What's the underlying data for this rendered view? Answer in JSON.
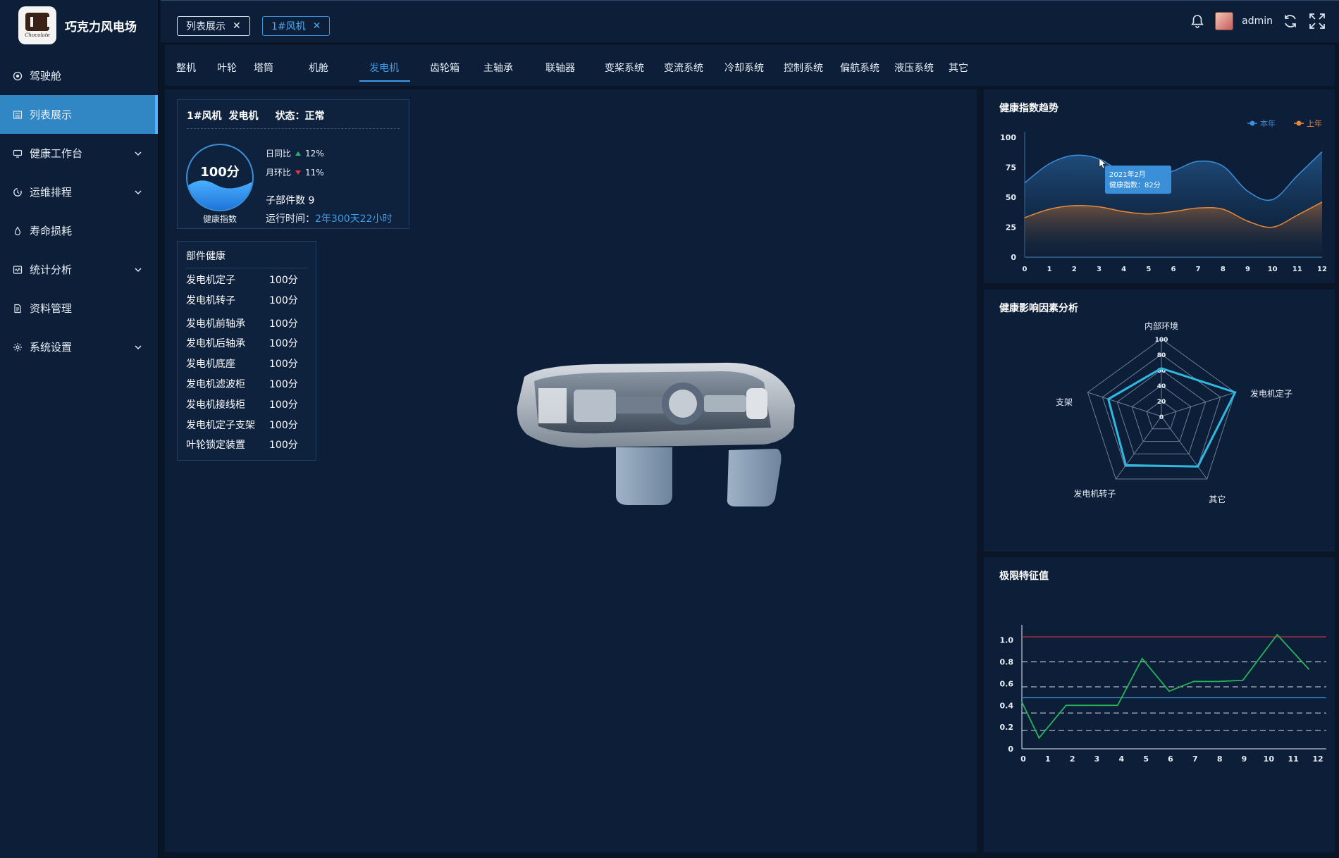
{
  "brand": {
    "name": "巧克力风电场",
    "logo_text": "Chocolate"
  },
  "sidebar": {
    "items": [
      {
        "label": "驾驶舱",
        "icon": "cockpit-icon",
        "active": false,
        "expandable": false
      },
      {
        "label": "列表展示",
        "icon": "list-icon",
        "active": true,
        "expandable": false
      },
      {
        "label": "健康工作台",
        "icon": "monitor-icon",
        "active": false,
        "expandable": true
      },
      {
        "label": "运维排程",
        "icon": "schedule-icon",
        "active": false,
        "expandable": true
      },
      {
        "label": "寿命损耗",
        "icon": "drop-icon",
        "active": false,
        "expandable": false
      },
      {
        "label": "统计分析",
        "icon": "chart-icon",
        "active": false,
        "expandable": true
      },
      {
        "label": "资料管理",
        "icon": "document-icon",
        "active": false,
        "expandable": false
      },
      {
        "label": "系统设置",
        "icon": "gear-icon",
        "active": false,
        "expandable": true
      }
    ]
  },
  "header": {
    "tabs": [
      {
        "label": "列表展示",
        "active": false
      },
      {
        "label": "1#风机",
        "active": true
      }
    ],
    "username": "admin"
  },
  "component_tabs": [
    "整机",
    "叶轮",
    "塔筒",
    "机舱",
    "发电机",
    "齿轮箱",
    "主轴承",
    "联轴器",
    "变桨系统",
    "变流系统",
    "冷却系统",
    "控制系统",
    "偏航系统",
    "液压系统",
    "其它"
  ],
  "active_component": "发电机",
  "status": {
    "turbine": "1#风机",
    "component": "发电机",
    "status_label": "状态：正常",
    "health_score": "100分",
    "health_value": 100,
    "health_label": "健康指数",
    "yoy_label": "日同比",
    "yoy_value": "12%",
    "mom_label": "月环比",
    "mom_value": "11%",
    "subcount": "子部件数 9",
    "runtime_label": "运行时间：",
    "runtime_value": "2年300天22小时"
  },
  "parts": {
    "title": "部件健康",
    "rows": [
      {
        "name": "发电机定子",
        "score": "100分"
      },
      {
        "name": "发电机转子",
        "score": "100分"
      },
      {
        "name": "发电机前轴承",
        "score": "100分"
      },
      {
        "name": "发电机后轴承",
        "score": "100分"
      },
      {
        "name": "发电机底座",
        "score": "100分"
      },
      {
        "name": "发电机滤波柜",
        "score": "100分"
      },
      {
        "name": "发电机接线柜",
        "score": "100分"
      },
      {
        "name": "发电机定子支架",
        "score": "100分"
      },
      {
        "name": "叶轮锁定装置",
        "score": "100分"
      }
    ]
  },
  "colors": {
    "accent": "#3d9be6",
    "series_this_year": "#3a8fd8",
    "series_last_year": "#e8893a",
    "limit_line": "#d9373f",
    "trend_line": "#27b35a"
  },
  "chart_data": [
    {
      "type": "area",
      "title": "健康指数趋势",
      "x": [
        0,
        1,
        2,
        3,
        4,
        5,
        6,
        7,
        8,
        9,
        10,
        11,
        12
      ],
      "yticks": [
        0,
        25,
        50,
        75,
        100
      ],
      "ylim": [
        0,
        100
      ],
      "legend_position": "top-right",
      "series": [
        {
          "name": "本年",
          "values": [
            62,
            78,
            85,
            82,
            70,
            66,
            72,
            80,
            76,
            55,
            48,
            68,
            88
          ]
        },
        {
          "name": "上年",
          "values": [
            33,
            40,
            43,
            42,
            38,
            36,
            38,
            41,
            40,
            30,
            25,
            35,
            46
          ]
        }
      ],
      "tooltip": {
        "title": "2021年2月",
        "text": "健康指数：82分"
      }
    },
    {
      "type": "radar",
      "title": "健康影响因素分析",
      "indicators": [
        "内部环境",
        "发电机定子",
        "其它",
        "发电机转子",
        "支架"
      ],
      "ticks": [
        "0",
        "20",
        "40",
        "60",
        "80",
        "100"
      ],
      "max": 100,
      "values": [
        62,
        100,
        80,
        78,
        72
      ]
    },
    {
      "type": "line",
      "title": "极限特征值",
      "x": [
        0,
        1,
        2,
        3,
        4,
        5,
        6,
        7,
        8,
        9,
        10,
        11,
        12
      ],
      "xticks": [
        "0",
        "1",
        "2",
        "3",
        "4",
        "5",
        "6",
        "7",
        "8",
        "9",
        "10",
        "11",
        "12"
      ],
      "yticks": [
        "0",
        "0.2",
        "0.4",
        "0.6",
        "0.8",
        "1.0"
      ],
      "ylim": [
        0,
        1.05
      ],
      "values": [
        0.43,
        0.1,
        0.4,
        0.4,
        0.4,
        0.83,
        0.53,
        0.62,
        0.62,
        0.63,
        1.05,
        0.73
      ],
      "value_x": [
        0,
        0.7,
        1.8,
        2.8,
        3.9,
        4.9,
        6,
        7,
        8,
        9,
        10.4,
        11.7
      ],
      "upper_limit": 1.03,
      "lower_limit": 0.47,
      "dashed_levels": [
        0.8,
        0.57,
        0.33,
        0.17
      ]
    }
  ]
}
